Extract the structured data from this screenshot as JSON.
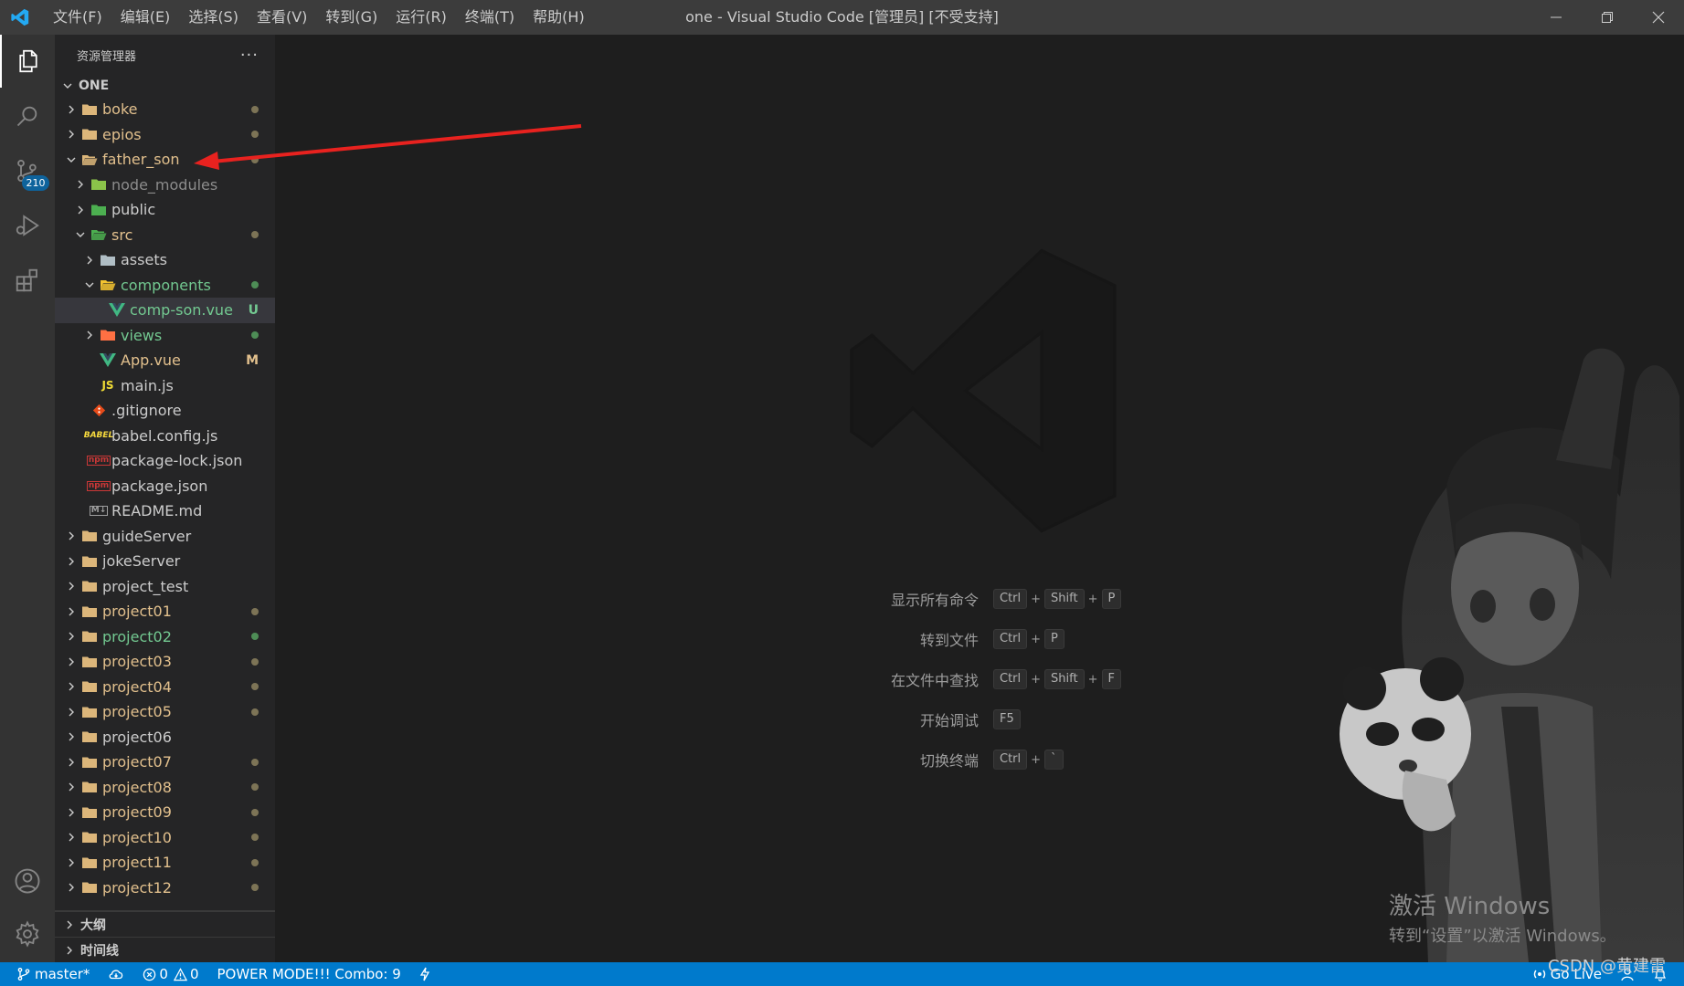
{
  "titlebar": {
    "menu": [
      "文件(F)",
      "编辑(E)",
      "选择(S)",
      "查看(V)",
      "转到(G)",
      "运行(R)",
      "终端(T)",
      "帮助(H)"
    ],
    "title": "one - Visual Studio Code [管理员] [不受支持]"
  },
  "activitybar": {
    "items": [
      "files-icon",
      "search-icon",
      "source-control-icon",
      "run-debug-icon",
      "extensions-icon",
      "account-icon",
      "settings-gear-icon"
    ],
    "scm_badge": "210"
  },
  "sidebar": {
    "title": "资源管理器",
    "more": "···",
    "root": "ONE",
    "tree": [
      {
        "label": "boke",
        "depth": 0,
        "kind": "folder",
        "expanded": false,
        "color": "mod",
        "deco": "dot"
      },
      {
        "label": "epios",
        "depth": 0,
        "kind": "folder",
        "expanded": false,
        "color": "mod",
        "deco": "dot"
      },
      {
        "label": "father_son",
        "depth": 0,
        "kind": "folder-open",
        "expanded": true,
        "color": "mod",
        "deco": "dot"
      },
      {
        "label": "node_modules",
        "depth": 1,
        "kind": "folder-node",
        "expanded": false,
        "color": "gray",
        "deco": ""
      },
      {
        "label": "public",
        "depth": 1,
        "kind": "folder-public",
        "expanded": false,
        "color": "white",
        "deco": ""
      },
      {
        "label": "src",
        "depth": 1,
        "kind": "folder-src",
        "expanded": true,
        "color": "mod",
        "deco": "dot"
      },
      {
        "label": "assets",
        "depth": 2,
        "kind": "folder-assets",
        "expanded": false,
        "color": "white",
        "deco": ""
      },
      {
        "label": "components",
        "depth": 2,
        "kind": "folder-components",
        "expanded": true,
        "color": "green",
        "deco": "dot-green"
      },
      {
        "label": "comp-son.vue",
        "depth": 3,
        "kind": "vue",
        "color": "green",
        "deco": "U",
        "selected": true
      },
      {
        "label": "views",
        "depth": 2,
        "kind": "folder-views",
        "expanded": false,
        "color": "green",
        "deco": "dot-green"
      },
      {
        "label": "App.vue",
        "depth": 2,
        "kind": "vue",
        "color": "mod",
        "deco": "M",
        "leaf": true
      },
      {
        "label": "main.js",
        "depth": 2,
        "kind": "js",
        "color": "white",
        "deco": "",
        "leaf": true
      },
      {
        "label": ".gitignore",
        "depth": 1,
        "kind": "git",
        "color": "white",
        "deco": "",
        "leaf": true
      },
      {
        "label": "babel.config.js",
        "depth": 1,
        "kind": "babel",
        "color": "white",
        "deco": "",
        "leaf": true
      },
      {
        "label": "package-lock.json",
        "depth": 1,
        "kind": "npm",
        "color": "white",
        "deco": "",
        "leaf": true
      },
      {
        "label": "package.json",
        "depth": 1,
        "kind": "npm",
        "color": "white",
        "deco": "",
        "leaf": true
      },
      {
        "label": "README.md",
        "depth": 1,
        "kind": "md",
        "color": "white",
        "deco": "",
        "leaf": true
      },
      {
        "label": "guideServer",
        "depth": 0,
        "kind": "folder",
        "expanded": false,
        "color": "white",
        "deco": ""
      },
      {
        "label": "jokeServer",
        "depth": 0,
        "kind": "folder",
        "expanded": false,
        "color": "white",
        "deco": ""
      },
      {
        "label": "project_test",
        "depth": 0,
        "kind": "folder",
        "expanded": false,
        "color": "white",
        "deco": ""
      },
      {
        "label": "project01",
        "depth": 0,
        "kind": "folder",
        "expanded": false,
        "color": "mod",
        "deco": "dot"
      },
      {
        "label": "project02",
        "depth": 0,
        "kind": "folder",
        "expanded": false,
        "color": "green",
        "deco": "dot-green"
      },
      {
        "label": "project03",
        "depth": 0,
        "kind": "folder",
        "expanded": false,
        "color": "mod",
        "deco": "dot"
      },
      {
        "label": "project04",
        "depth": 0,
        "kind": "folder",
        "expanded": false,
        "color": "mod",
        "deco": "dot"
      },
      {
        "label": "project05",
        "depth": 0,
        "kind": "folder",
        "expanded": false,
        "color": "mod",
        "deco": "dot"
      },
      {
        "label": "project06",
        "depth": 0,
        "kind": "folder",
        "expanded": false,
        "color": "white",
        "deco": ""
      },
      {
        "label": "project07",
        "depth": 0,
        "kind": "folder",
        "expanded": false,
        "color": "mod",
        "deco": "dot"
      },
      {
        "label": "project08",
        "depth": 0,
        "kind": "folder",
        "expanded": false,
        "color": "mod",
        "deco": "dot"
      },
      {
        "label": "project09",
        "depth": 0,
        "kind": "folder",
        "expanded": false,
        "color": "mod",
        "deco": "dot"
      },
      {
        "label": "project10",
        "depth": 0,
        "kind": "folder",
        "expanded": false,
        "color": "mod",
        "deco": "dot"
      },
      {
        "label": "project11",
        "depth": 0,
        "kind": "folder",
        "expanded": false,
        "color": "mod",
        "deco": "dot"
      },
      {
        "label": "project12",
        "depth": 0,
        "kind": "folder",
        "expanded": false,
        "color": "mod",
        "deco": "dot"
      }
    ],
    "outline": "大纲",
    "timeline": "时间线"
  },
  "editor": {
    "shortcuts": [
      {
        "label": "显示所有命令",
        "keys": [
          "Ctrl",
          "Shift",
          "P"
        ]
      },
      {
        "label": "转到文件",
        "keys": [
          "Ctrl",
          "P"
        ]
      },
      {
        "label": "在文件中查找",
        "keys": [
          "Ctrl",
          "Shift",
          "F"
        ]
      },
      {
        "label": "开始调试",
        "keys": [
          "F5"
        ]
      },
      {
        "label": "切换终端",
        "keys": [
          "Ctrl",
          "`"
        ]
      }
    ],
    "activate_line1": "激活 Windows",
    "activate_line2": "转到“设置”以激活 Windows。"
  },
  "statusbar": {
    "branch": "master*",
    "errors": "0",
    "warnings": "0",
    "power_mode": "POWER MODE!!! Combo: 9",
    "go_live": "Go Live"
  },
  "csdn_watermark": "CSDN @黄建雷",
  "colors": {
    "titlebar": "#3c3c3c",
    "activitybar": "#333333",
    "sidebar": "#252526",
    "editor": "#1e1e1e",
    "statusbar": "#007acc",
    "modified": "#e2c08d",
    "untracked": "#73c991"
  }
}
